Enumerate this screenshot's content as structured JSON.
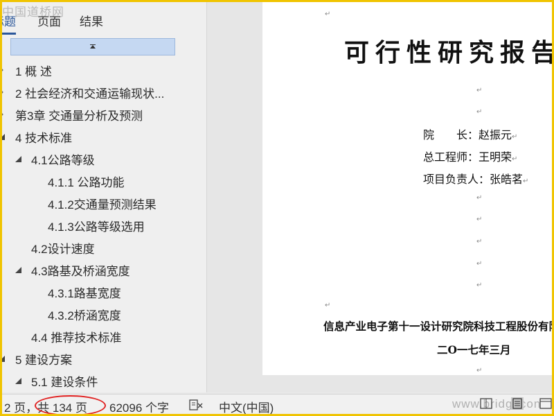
{
  "watermark_top": "中国道桥网",
  "watermark_bottom": "www.bridgecon",
  "nav": {
    "tabs": [
      {
        "label": "标题",
        "active": true
      },
      {
        "label": "页面",
        "active": false
      },
      {
        "label": "结果",
        "active": false
      }
    ],
    "outline": [
      {
        "label": "1 概 述",
        "level": 1,
        "toggle": "collapsed"
      },
      {
        "label": "2 社会经济和交通运输现状...",
        "level": 1,
        "toggle": "collapsed"
      },
      {
        "label": "第3章 交通量分析及预测",
        "level": 1,
        "toggle": "collapsed"
      },
      {
        "label": "4 技术标准",
        "level": 1,
        "toggle": "expanded"
      },
      {
        "label": "4.1公路等级",
        "level": 2,
        "toggle": "expanded"
      },
      {
        "label": "4.1.1 公路功能",
        "level": 3,
        "toggle": "none"
      },
      {
        "label": "4.1.2交通量预测结果",
        "level": 3,
        "toggle": "none"
      },
      {
        "label": "4.1.3公路等级选用",
        "level": 3,
        "toggle": "none"
      },
      {
        "label": "4.2设计速度",
        "level": 2,
        "toggle": "none"
      },
      {
        "label": "4.3路基及桥涵宽度",
        "level": 2,
        "toggle": "expanded"
      },
      {
        "label": "4.3.1路基宽度",
        "level": 3,
        "toggle": "none"
      },
      {
        "label": "4.3.2桥涵宽度",
        "level": 3,
        "toggle": "none"
      },
      {
        "label": "4.4 推荐技术标准",
        "level": 2,
        "toggle": "none"
      },
      {
        "label": "5 建设方案",
        "level": 1,
        "toggle": "expanded"
      },
      {
        "label": "5.1 建设条件",
        "level": 2,
        "toggle": "expanded"
      }
    ]
  },
  "document": {
    "title": "可行性研究报告",
    "paragraph_mark": "↵",
    "info": [
      {
        "key": "院　　长：",
        "value": "赵振元"
      },
      {
        "key": "总工程师：",
        "value": "王明荣"
      },
      {
        "key": "项目负责人：",
        "value": "张皓茗"
      }
    ],
    "organization": "信息产业电子第十一设计研究院科技工程股份有限公司",
    "date": "二O一七年三月"
  },
  "status": {
    "page_info": "2 页，共 134 页",
    "word_count": "62096 个字",
    "language": "中文(中国)"
  },
  "colors": {
    "border": "#f0c400",
    "accent": "#2b579a",
    "highlight": "#c5d8f2",
    "annotation": "#e02020"
  }
}
